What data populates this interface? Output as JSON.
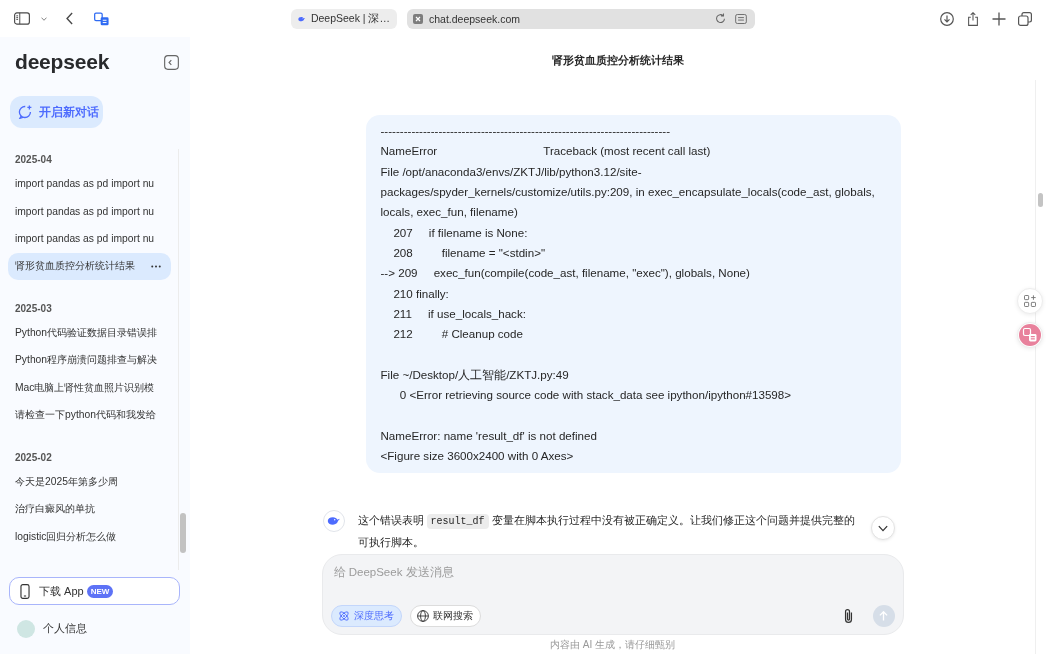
{
  "browser": {
    "tab_title": "DeepSeek | 深…",
    "url": "chat.deepseek.com"
  },
  "sidebar": {
    "logo": "deepseek",
    "new_chat": "开启新对话",
    "sections": [
      {
        "date": "2025-04",
        "items": [
          {
            "title": "import pandas as pd import nu",
            "selected": false
          },
          {
            "title": "import pandas as pd import nu",
            "selected": false
          },
          {
            "title": "import pandas as pd import nu",
            "selected": false
          },
          {
            "title": "肾形贫血质控分析统计结果",
            "selected": true
          }
        ]
      },
      {
        "date": "2025-03",
        "items": [
          {
            "title": "Python代码验证数据目录错误排",
            "selected": false
          },
          {
            "title": "Python程序崩溃问题排查与解决",
            "selected": false
          },
          {
            "title": "Mac电脑上肾性贫血照片识别模",
            "selected": false
          },
          {
            "title": "请检查一下python代码和我发给",
            "selected": false
          }
        ]
      },
      {
        "date": "2025-02",
        "items": [
          {
            "title": "今天是2025年第多少周",
            "selected": false
          },
          {
            "title": "治疗白癜风的单抗",
            "selected": false
          },
          {
            "title": "logistic回归分析怎么做",
            "selected": false
          }
        ]
      }
    ],
    "download": {
      "label": "下载 App",
      "badge": "NEW"
    },
    "profile": "个人信息"
  },
  "chat": {
    "title": "肾形贫血质控分析统计结果",
    "user_message": "---------------------------------------------------------------------------\nNameError                                 Traceback (most recent call last)\nFile /opt/anaconda3/envs/ZKTJ/lib/python3.12/site-packages/spyder_kernels/customize/utils.py:209, in exec_encapsulate_locals(code_ast, globals, locals, exec_fun, filename)\n    207     if filename is None:\n    208         filename = \"<stdin>\"\n--> 209     exec_fun(compile(code_ast, filename, \"exec\"), globals, None)\n    210 finally:\n    211     if use_locals_hack:\n    212         # Cleanup code\n\nFile ~/Desktop/人工智能/ZKTJ.py:49\n      0 <Error retrieving source code with stack_data see ipython/ipython#13598>\n\nNameError: name 'result_df' is not defined\n<Figure size 3600x2400 with 0 Axes>",
    "assistant_message": [
      {
        "kind": "text",
        "text": "这个错误表明 "
      },
      {
        "kind": "code",
        "text": "result_df"
      },
      {
        "kind": "text",
        "text": " 变量在脚本执行过程中没有被正确定义。让我们修正这个问题并提供完整的可执行脚本。"
      }
    ]
  },
  "composer": {
    "placeholder": "给 DeepSeek 发送消息",
    "toggles": [
      {
        "kind": "deep_think",
        "label": "深度思考",
        "selected": true
      },
      {
        "kind": "web_search",
        "label": "联网搜索",
        "selected": false
      }
    ],
    "send_button": {
      "disabled": true
    }
  },
  "disclaimer": "内容由 AI 生成，请仔细甄别"
}
